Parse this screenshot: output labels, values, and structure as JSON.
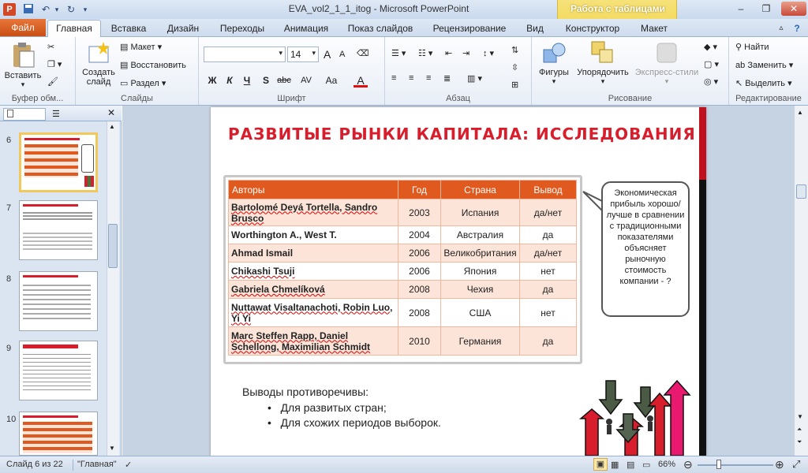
{
  "app": {
    "title": "EVA_vol2_1_1_itog  -  Microsoft PowerPoint",
    "app_letter": "P",
    "context_tab_group": "Работа с таблицами",
    "accent": "#d24726"
  },
  "tabs": {
    "file": "Файл",
    "items": [
      "Главная",
      "Вставка",
      "Дизайн",
      "Переходы",
      "Анимация",
      "Показ слайдов",
      "Рецензирование",
      "Вид",
      "Конструктор",
      "Макет"
    ]
  },
  "ribbon": {
    "clipboard": {
      "paste": "Вставить",
      "label": "Буфер обм..."
    },
    "slides": {
      "new_slide_line1": "Создать",
      "new_slide_line2": "слайд",
      "layout": "Макет",
      "reset": "Восстановить",
      "section": "Раздел",
      "label": "Слайды"
    },
    "font": {
      "name_value": "",
      "size_value": "14",
      "label": "Шрифт",
      "bold": "Ж",
      "italic": "К",
      "underline": "Ч",
      "shadow": "S",
      "strike": "abc",
      "spacing": "AV",
      "case": "Aa",
      "color": "A",
      "grow": "A",
      "shrink": "A"
    },
    "paragraph": {
      "label": "Абзац"
    },
    "drawing": {
      "shapes": "Фигуры",
      "arrange": "Упорядочить",
      "quick_styles": "Экспресс-стили",
      "label": "Рисование"
    },
    "editing": {
      "find": "Найти",
      "replace": "Заменить",
      "select": "Выделить",
      "label": "Редактирование"
    }
  },
  "thumbnails": [
    {
      "num": "6",
      "selected": true
    },
    {
      "num": "7",
      "selected": false
    },
    {
      "num": "8",
      "selected": false
    },
    {
      "num": "9",
      "selected": false
    },
    {
      "num": "10",
      "selected": false
    }
  ],
  "slide": {
    "title": "РАЗВИТЫЕ  РЫНКИ КАПИТАЛА:  ИССЛЕДОВАНИЯ",
    "table": {
      "headers": [
        "Авторы",
        "Год",
        "Страна",
        "Вывод"
      ],
      "rows": [
        [
          "Bartolomé  Deyá  Tortella,  Sandro Brusco",
          "2003",
          "Испания",
          "да/нет"
        ],
        [
          "Worthington A., West T.",
          "2004",
          "Австралия",
          "да"
        ],
        [
          "Ahmad  Ismail",
          "2006",
          "Великобритания",
          "да/нет"
        ],
        [
          "Chikashi  Tsuji",
          "2006",
          "Япония",
          "нет"
        ],
        [
          "Gabriela  Chmelíková",
          "2008",
          "Чехия",
          "да"
        ],
        [
          "Nuttawat  Visaltanachoti,  Robin  Luo, Yi Yi",
          "2008",
          "США",
          "нет"
        ],
        [
          "Marc Steffen Rapp, Daniel Schellong,  Maximilian  Schmidt",
          "2010",
          "Германия",
          "да"
        ]
      ]
    },
    "callout": "Экономическая прибыль хорошо/лучше  в сравнении с традиционными показателями объясняет рыночную стоимость компании - ?",
    "conclusion": "Выводы противоречивы:",
    "bullets": [
      "Для развитых стран;",
      "Для схожих периодов выборок."
    ]
  },
  "status": {
    "slide_info": "Слайд 6 из 22",
    "theme": "\"Главная\"",
    "zoom": "66%"
  }
}
